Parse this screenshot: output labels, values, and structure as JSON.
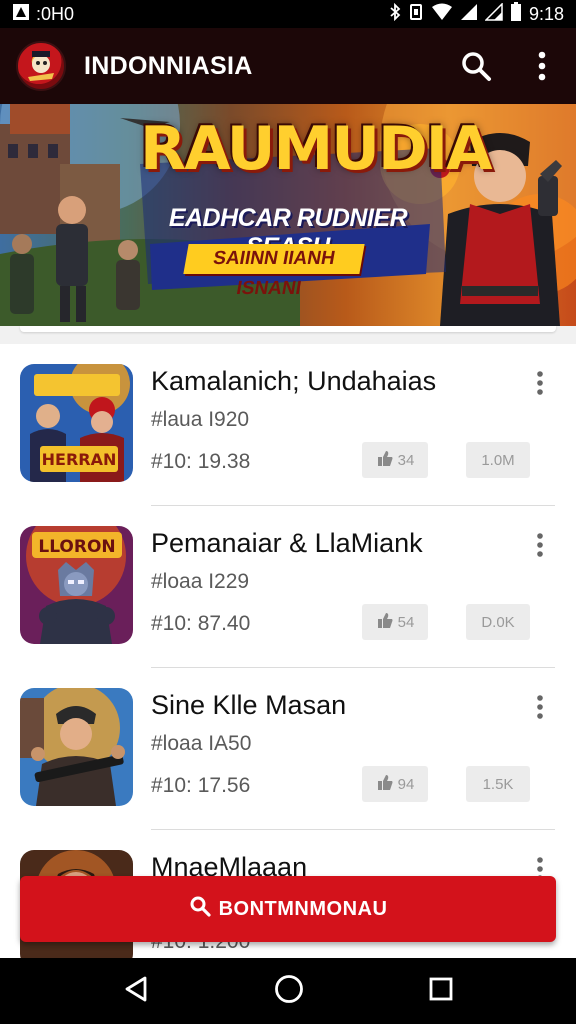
{
  "status_bar": {
    "left_text": ":0H0",
    "time": "9:18"
  },
  "app_bar": {
    "title": "INDONNIASIA",
    "search_icon": "search-icon",
    "more_icon": "more-vert-icon"
  },
  "banner": {
    "title": "RAUMUDIA",
    "subtitle": "EADHCAR RUDNIER SEASH",
    "ribbon": "SAIINN IIANH ISNANI",
    "colors": {
      "title": "#ffcf2e",
      "ribbon": "#ffcc1f"
    }
  },
  "items": [
    {
      "title": "Kamalanich; Undahaias",
      "sub": "#laua I920",
      "meta": "#10: 19.38",
      "like": "34",
      "size": "1.0M",
      "icon_text": "HERRAN"
    },
    {
      "title": "Pemanaiar & LlaMiank",
      "sub": "#loaa I229",
      "meta": "#10: 87.40",
      "like": "54",
      "size": "D.0K",
      "icon_text": "LLORON"
    },
    {
      "title": "Sine Klle Masan",
      "sub": "#loaa IA50",
      "meta": "#10: 17.56",
      "like": "94",
      "size": "1.5K",
      "icon_text": ""
    },
    {
      "title": "MnaeMlaaan",
      "sub": "",
      "meta": "#10: 1:200",
      "like": "",
      "size": "",
      "icon_text": ""
    }
  ],
  "cta": {
    "label": "BONTMNMONAU",
    "color": "#d3121b"
  },
  "nav": {
    "back_icon": "back-icon",
    "home_icon": "home-icon",
    "recents_icon": "recents-icon"
  }
}
